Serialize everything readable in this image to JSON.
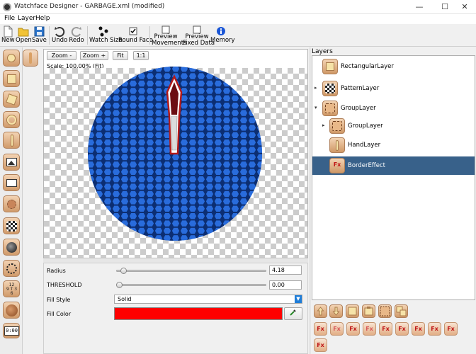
{
  "window": {
    "title": "Watchface Designer - GARBAGE.xml (modified)",
    "controls": [
      "—",
      "☐",
      "✕"
    ]
  },
  "menu": [
    "File",
    "Layer",
    "Help"
  ],
  "toolbar": {
    "new": "New",
    "open": "Open",
    "save": "Save",
    "undo": "Undo",
    "redo": "Redo",
    "watch_size": "Watch Size",
    "round_face": "Round Face",
    "round_face_checked": true,
    "preview_movements_1": "Preview",
    "preview_movements_2": "Movements",
    "preview_fixed_1": "Preview",
    "preview_fixed_2": "Fixed Data",
    "memory": "Memory"
  },
  "canvas": {
    "zoom_out": "Zoom -",
    "zoom_in": "Zoom +",
    "fit": "Fit",
    "one_to_one": "1:1",
    "scale": "Scale:  100.00%  (Fit)",
    "face_color": "#1e63d8",
    "hand_color": "#b21a1a"
  },
  "palette_clock_text": "0:00",
  "properties": {
    "radius_label": "Radius",
    "radius_value": "4.18",
    "radius_fraction": 0.03,
    "threshold_label": "THRESHOLD",
    "threshold_value": "0.00",
    "threshold_fraction": 0.0,
    "fill_style_label": "Fill Style",
    "fill_style_value": "Solid",
    "fill_color_label": "Fill Color",
    "fill_color": "#ff0000"
  },
  "layers": {
    "title": "Layers",
    "items": [
      {
        "name": "RectangularLayer",
        "level": 0,
        "arrow": ""
      },
      {
        "name": "PatternLayer",
        "level": 0,
        "arrow": "▸"
      },
      {
        "name": "GroupLayer",
        "level": 0,
        "arrow": "▾"
      },
      {
        "name": "GroupLayer",
        "level": 1,
        "arrow": "▸"
      },
      {
        "name": "HandLayer",
        "level": 1,
        "arrow": ""
      },
      {
        "name": "BorderEffect",
        "level": 1,
        "arrow": "",
        "selected": true
      }
    ]
  },
  "effect_buttons": [
    "Fx",
    "Fx",
    "Fx",
    "Fx",
    "Fx",
    "Fx",
    "Fx",
    "Fx",
    "Fx",
    "Fx"
  ]
}
